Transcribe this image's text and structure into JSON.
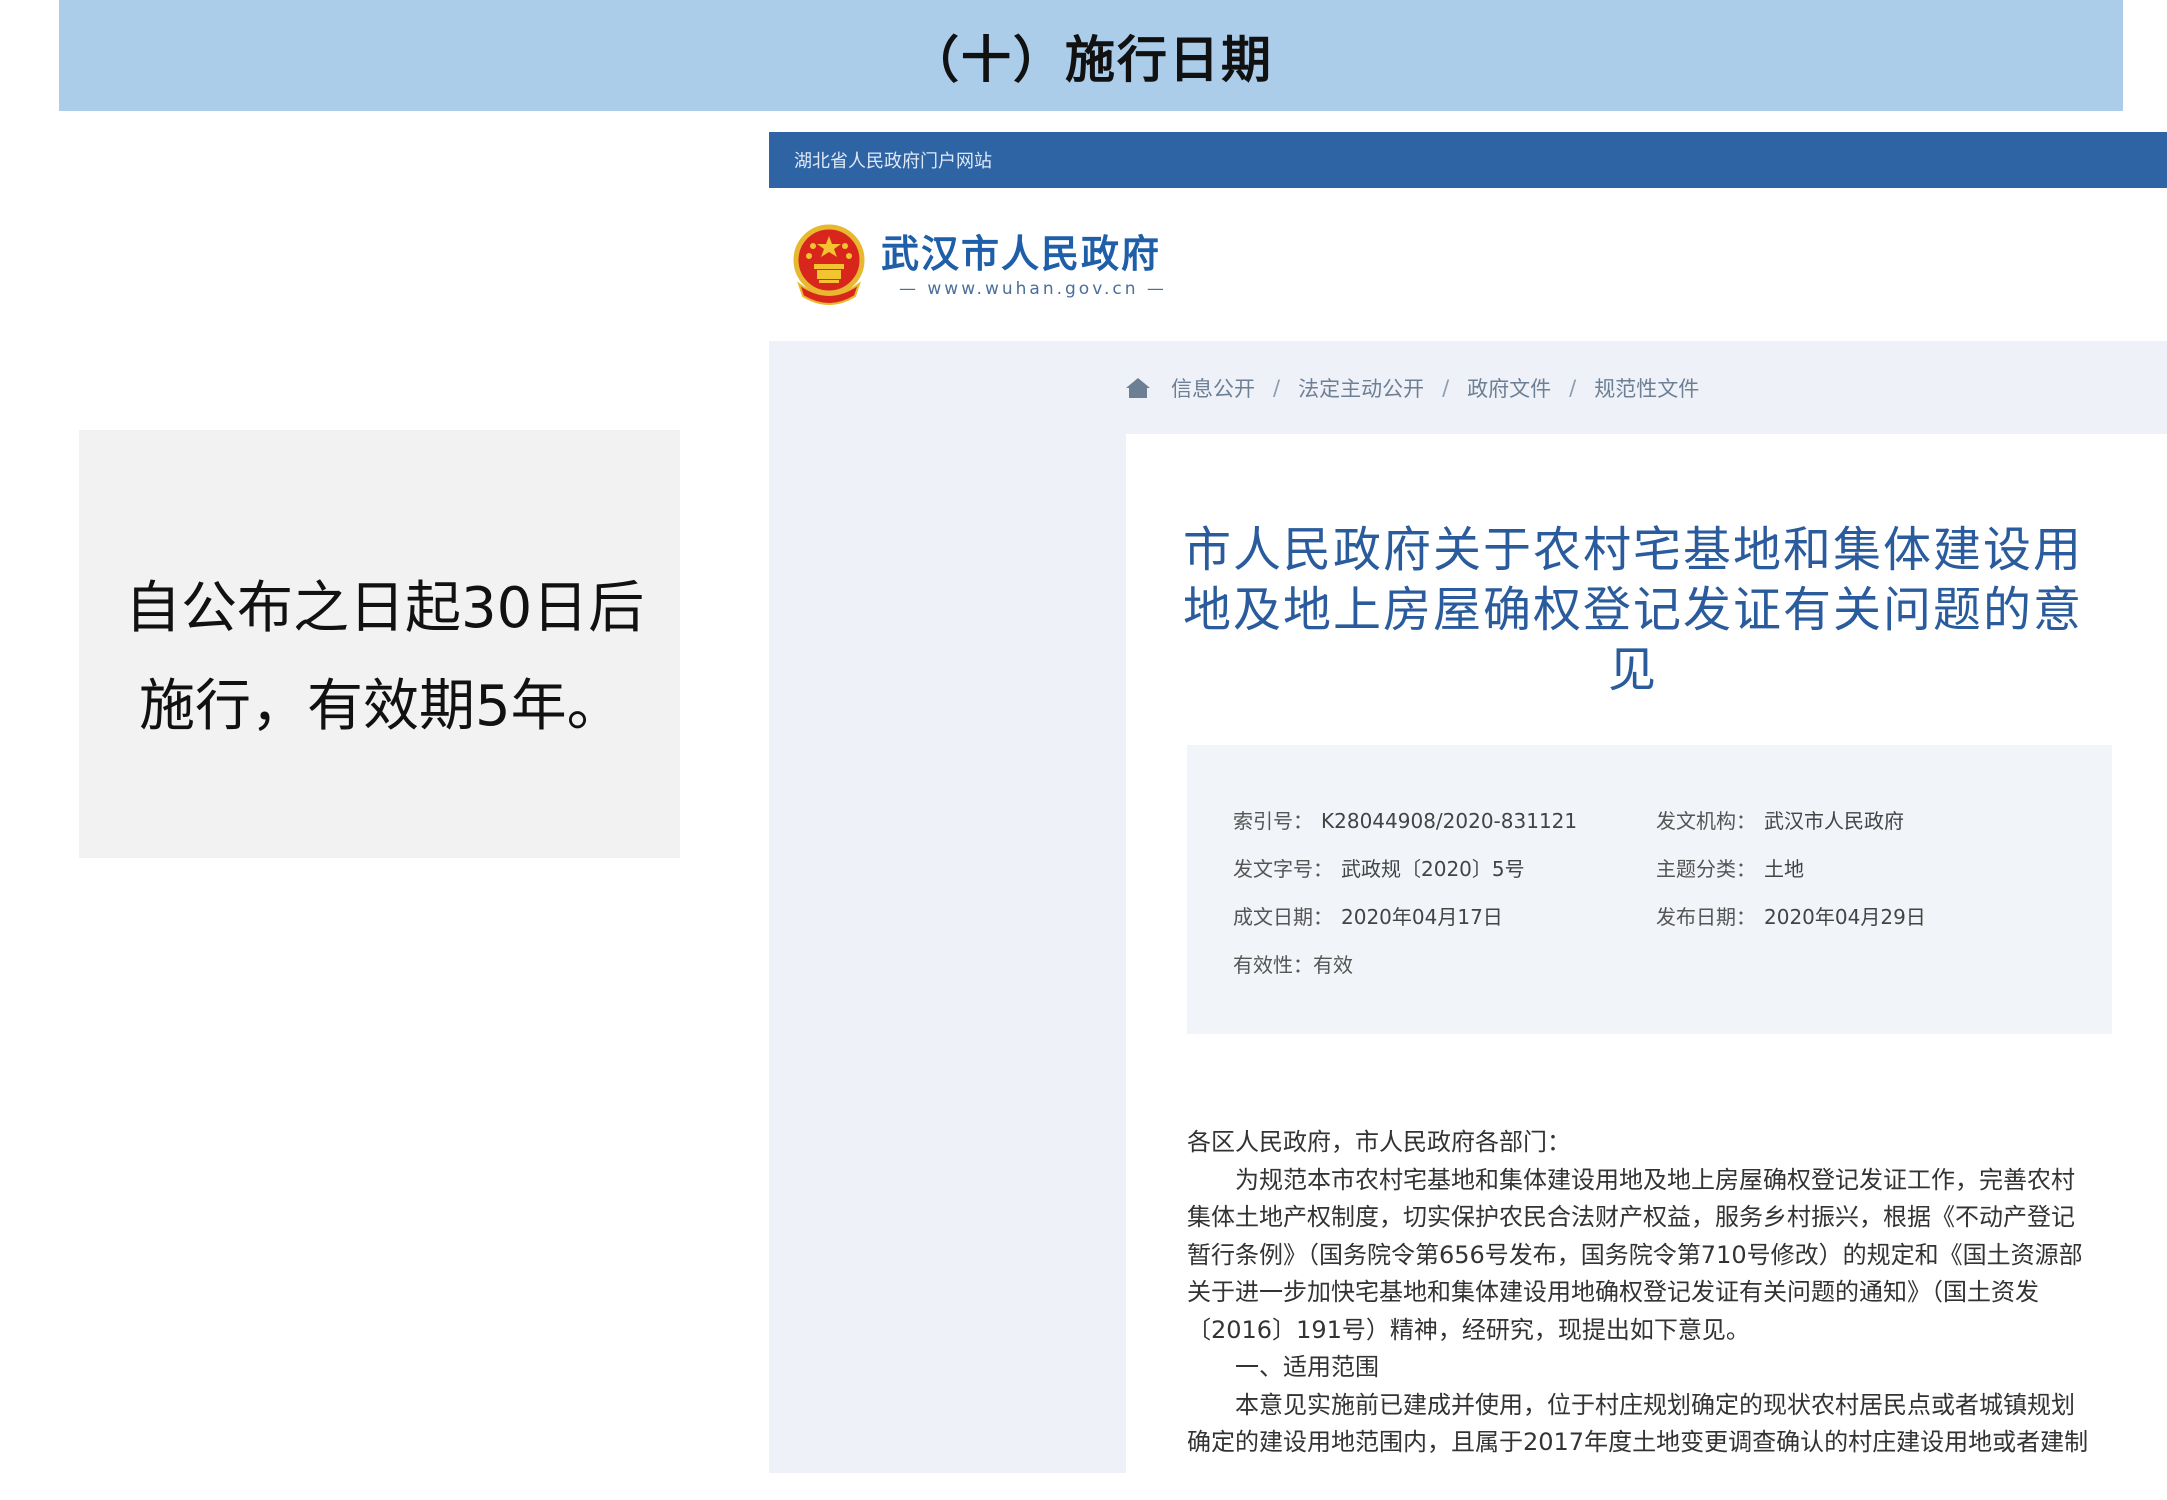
{
  "slide": {
    "title": "（十）施行日期",
    "callout_line1": "自公布之日起30日后",
    "callout_line2": "施行，有效期5年。"
  },
  "website": {
    "portal_bar_text": "湖北省人民政府门户网站",
    "brand_name": "武汉市人民政府",
    "brand_url": "www.wuhan.gov.cn",
    "breadcrumb": [
      "信息公开",
      "法定主动公开",
      "政府文件",
      "规范性文件"
    ],
    "breadcrumb_separator": "/",
    "doc_title": "市人民政府关于农村宅基地和集体建设用地及地上房屋确权登记发证有关问题的意见",
    "meta": {
      "index_no_label": "索引号：",
      "index_no": "K28044908/2020-831121",
      "issuer_label": "发文机构：",
      "issuer": "武汉市人民政府",
      "doc_no_label": "发文字号：",
      "doc_no": "武政规〔2020〕5号",
      "topic_label": "主题分类：",
      "topic": "土地",
      "created_label": "成文日期：",
      "created": "2020年04月17日",
      "published_label": "发布日期：",
      "published": "2020年04月29日",
      "validity": "有效性：有效"
    },
    "body": {
      "salutation": "各区人民政府，市人民政府各部门：",
      "para1": "为规范本市农村宅基地和集体建设用地及地上房屋确权登记发证工作，完善农村集体土地产权制度，切实保护农民合法财产权益，服务乡村振兴，根据《不动产登记暂行条例》（国务院令第656号发布，国务院令第710号修改）的规定和《国土资源部关于进一步加快宅基地和集体建设用地确权登记发证有关问题的通知》（国土资发〔2016〕191号）精神，经研究，现提出如下意见。",
      "section1": "一、适用范围",
      "para2": "本意见实施前已建成并使用，位于村庄规划确定的现状农村居民点或者城镇规划确定的建设用地范围内，且属于2017年度土地变更调查确认的村庄建设用地或者建制"
    }
  },
  "colors": {
    "title_bar": "#abcdea",
    "callout_bg": "#f2f2f2",
    "portal_bar": "#2e63a4",
    "brand_blue": "#1f5ea8",
    "doc_title": "#2a5b9c",
    "web_bg": "#eef2f8",
    "meta_bg": "#f1f4f9"
  },
  "icons": {
    "emblem": "national-emblem-icon",
    "home": "home-icon"
  }
}
